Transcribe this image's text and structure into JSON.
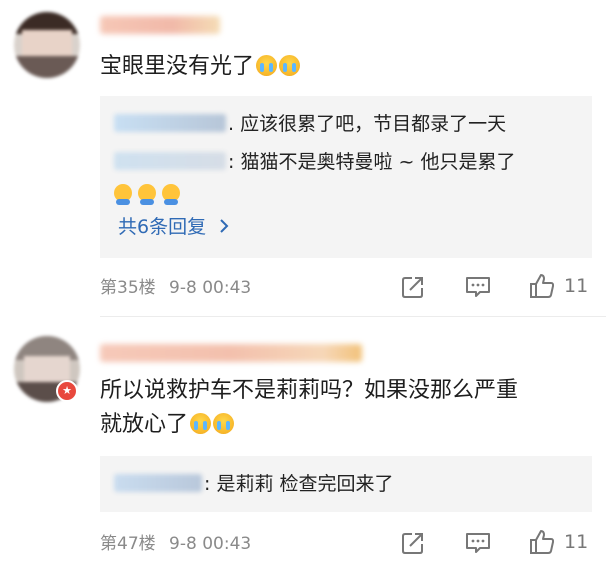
{
  "comments": [
    {
      "text": "宝眼里没有光了",
      "replies": [
        {
          "text": ". 应该很累了吧，节目都录了一天"
        },
        {
          "text": ": 猫猫不是奥特曼啦 ~ 他只是累了"
        }
      ],
      "more_replies_label": "共6条回复",
      "floor": "第35楼",
      "time": "9-8 00:43",
      "like_count": "11"
    },
    {
      "text_line1": "所以说救护车不是莉莉吗？如果没那么严重",
      "text_line2": "就放心了",
      "replies": [
        {
          "text": ": 是莉莉 检查完回来了"
        }
      ],
      "floor": "第47楼",
      "time": "9-8 00:43",
      "like_count": "11"
    }
  ],
  "icons": {
    "share": "share-icon",
    "comment": "comment-icon",
    "like": "thumbs-up-icon",
    "chevron": "chevron-right-icon",
    "emoji": "crying-face-icon",
    "mini_emoji": "hug-emoji-icon",
    "badge": "verified-badge-icon"
  },
  "colors": {
    "link": "#2f6ab5",
    "reply_bg": "#f4f4f4",
    "meta_text": "#8a8a8a",
    "badge": "#e8483d"
  }
}
